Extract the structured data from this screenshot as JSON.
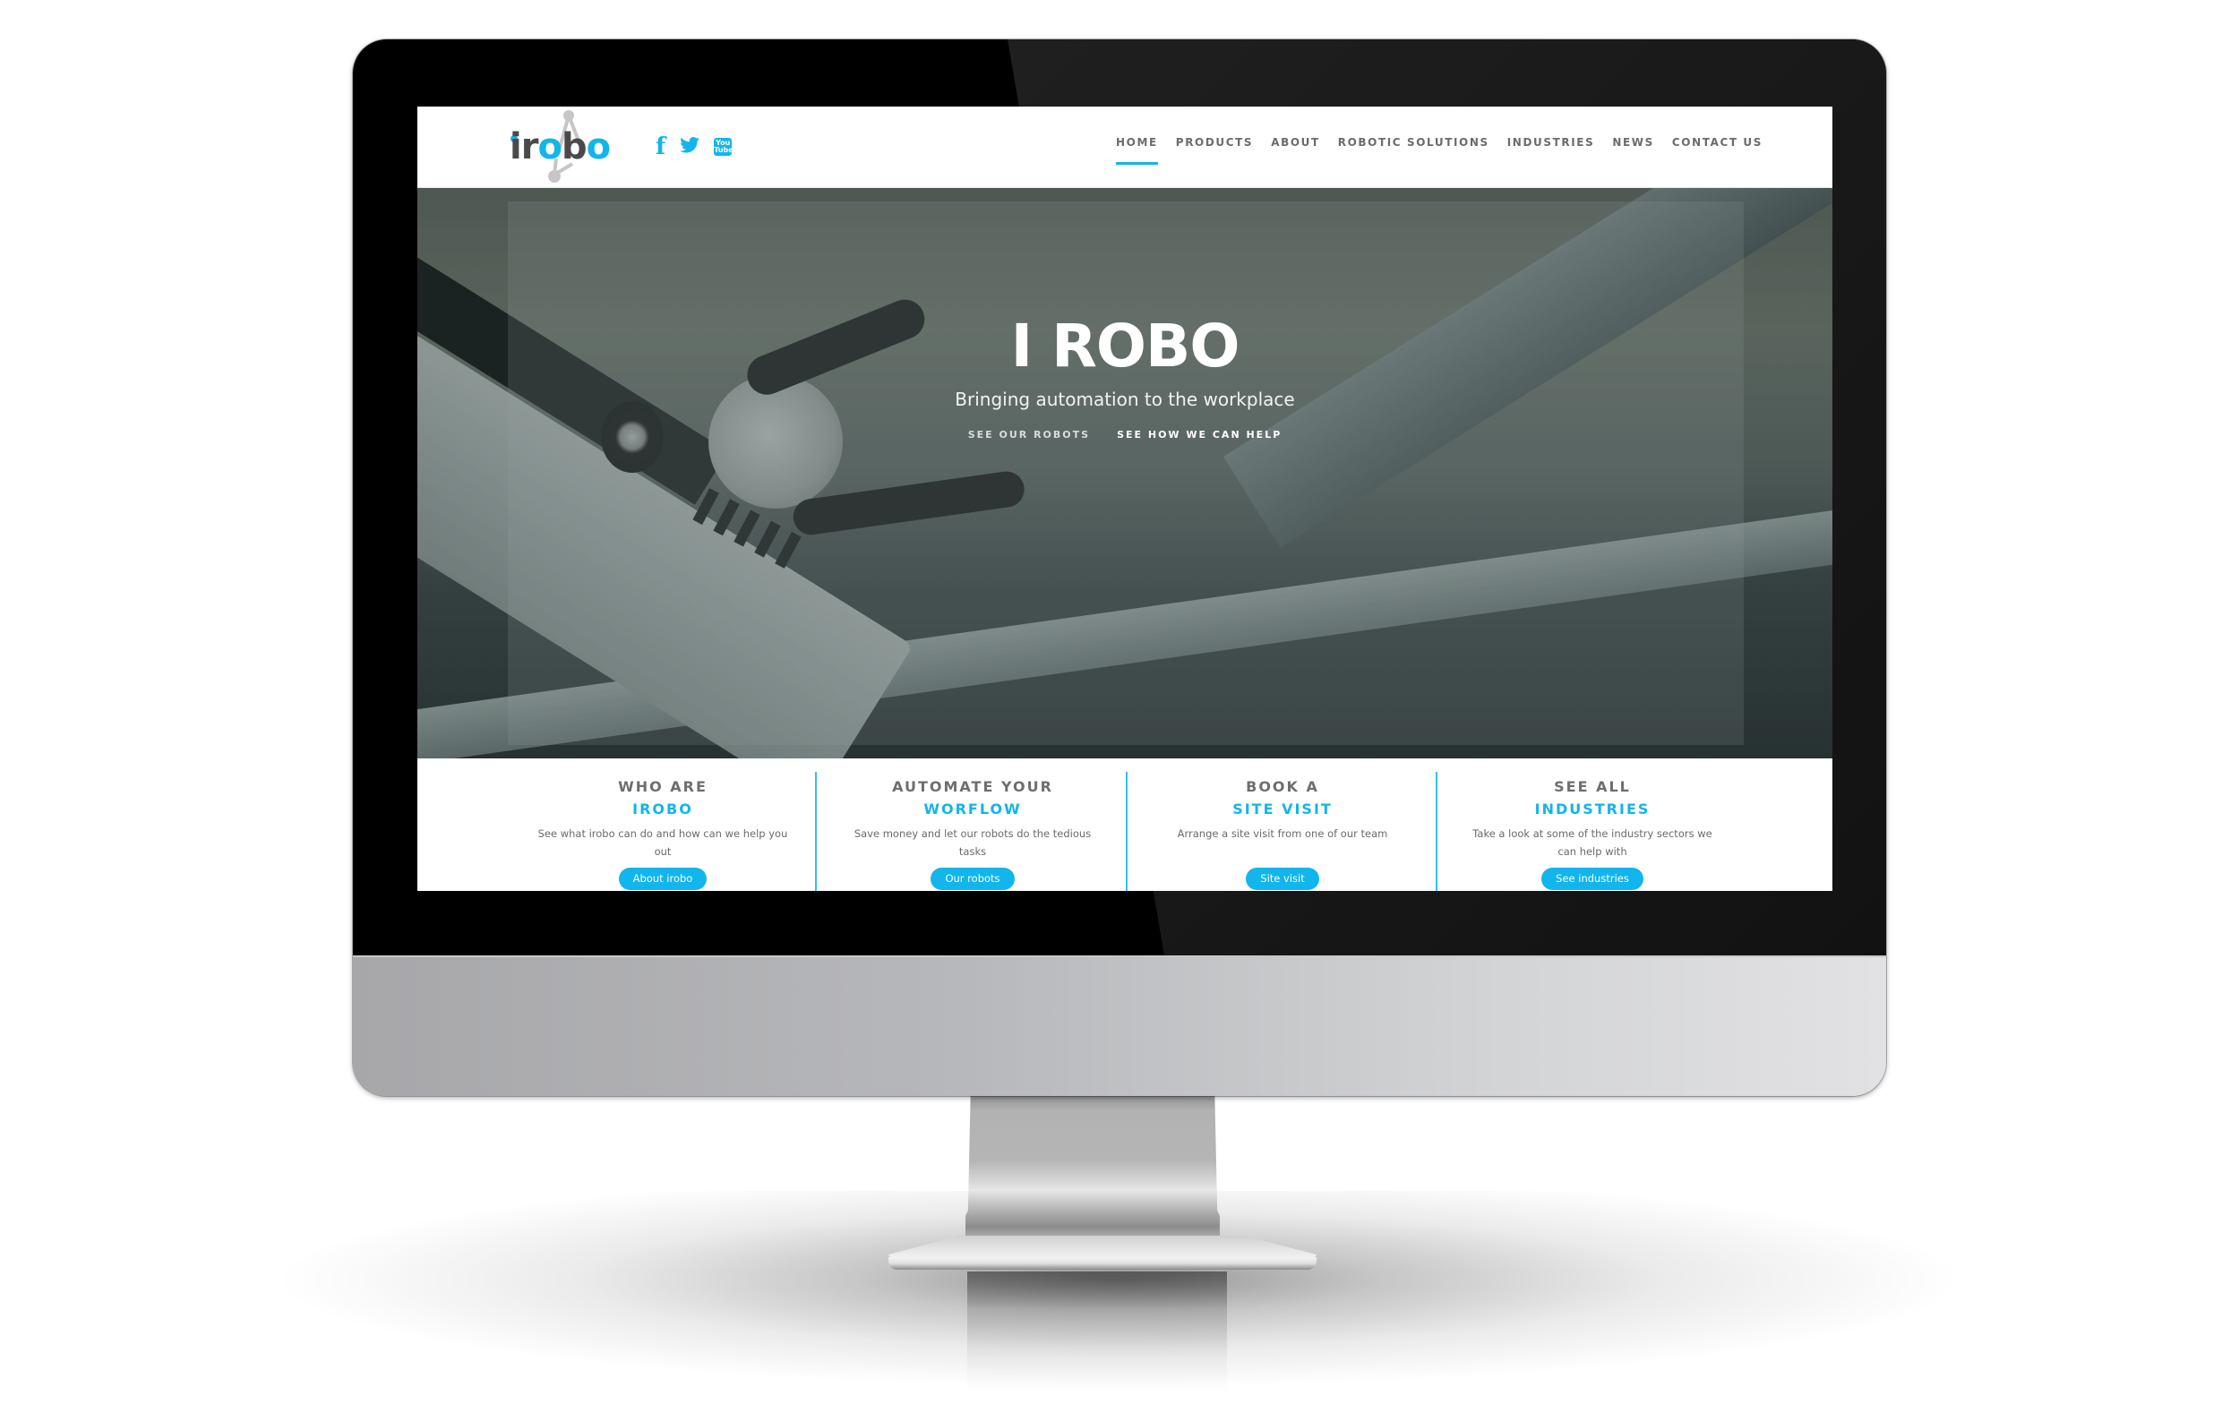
{
  "site": {
    "logo": {
      "part1": "i",
      "part2": "r",
      "part3": "o",
      "part4": "b",
      "part5": "o"
    },
    "social": [
      {
        "name": "facebook",
        "glyph": "f"
      },
      {
        "name": "twitter",
        "glyph": "🐦"
      },
      {
        "name": "youtube",
        "glyph_top": "You",
        "glyph_bottom": "Tube"
      }
    ],
    "nav": [
      {
        "label": "HOME",
        "active": true
      },
      {
        "label": "PRODUCTS"
      },
      {
        "label": "ABOUT"
      },
      {
        "label": "ROBOTIC SOLUTIONS"
      },
      {
        "label": "INDUSTRIES"
      },
      {
        "label": "NEWS"
      },
      {
        "label": "CONTACT US"
      }
    ],
    "accent_color": "#12b5ec"
  },
  "hero": {
    "title": "I ROBO",
    "subtitle": "Bringing automation to the workplace",
    "links": [
      "SEE OUR ROBOTS",
      "SEE HOW WE CAN HELP"
    ]
  },
  "cards": [
    {
      "heading": "WHO ARE",
      "highlight": "IROBO",
      "text": "See what irobo can do and how can we help you out",
      "button": "About irobo"
    },
    {
      "heading": "AUTOMATE YOUR",
      "highlight": "WORFLOW",
      "text": "Save money and let our robots do the tedious tasks",
      "button": "Our robots"
    },
    {
      "heading": "BOOK A",
      "highlight": "SITE VISIT",
      "text": "Arrange a site visit from one of our team",
      "button": "Site visit"
    },
    {
      "heading": "SEE ALL",
      "highlight": "INDUSTRIES",
      "text": "Take a look at some of the industry sectors we can help with",
      "button": "See industries"
    }
  ]
}
